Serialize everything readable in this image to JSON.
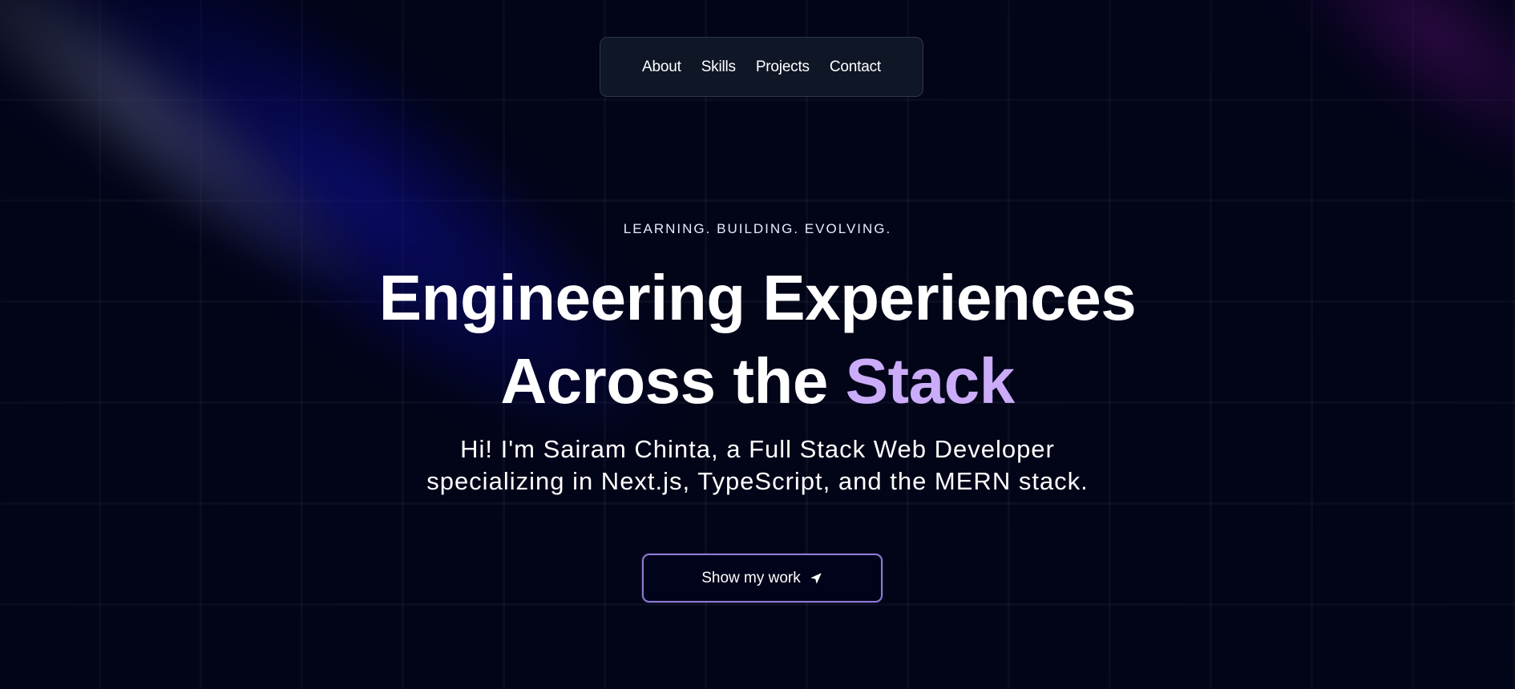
{
  "nav": {
    "items": [
      {
        "label": "About"
      },
      {
        "label": "Skills"
      },
      {
        "label": "Projects"
      },
      {
        "label": "Contact"
      }
    ]
  },
  "hero": {
    "eyebrow": "LEARNING. BUILDING. EVOLVING.",
    "headline_line1": "Engineering Experiences",
    "headline_line2_prefix": "Across the ",
    "headline_line2_accent": "Stack",
    "intro_line1": "Hi! I'm Sairam Chinta, a Full Stack Web Developer",
    "intro_line2": "specializing in Next.js, TypeScript, and the MERN stack.",
    "cta_label": "Show my work",
    "cta_icon": "send-arrow-icon"
  },
  "colors": {
    "background": "#000319",
    "accent": "#cbacf9",
    "cta_border": "#8b7ad6",
    "navbar_bg": "#111928"
  }
}
